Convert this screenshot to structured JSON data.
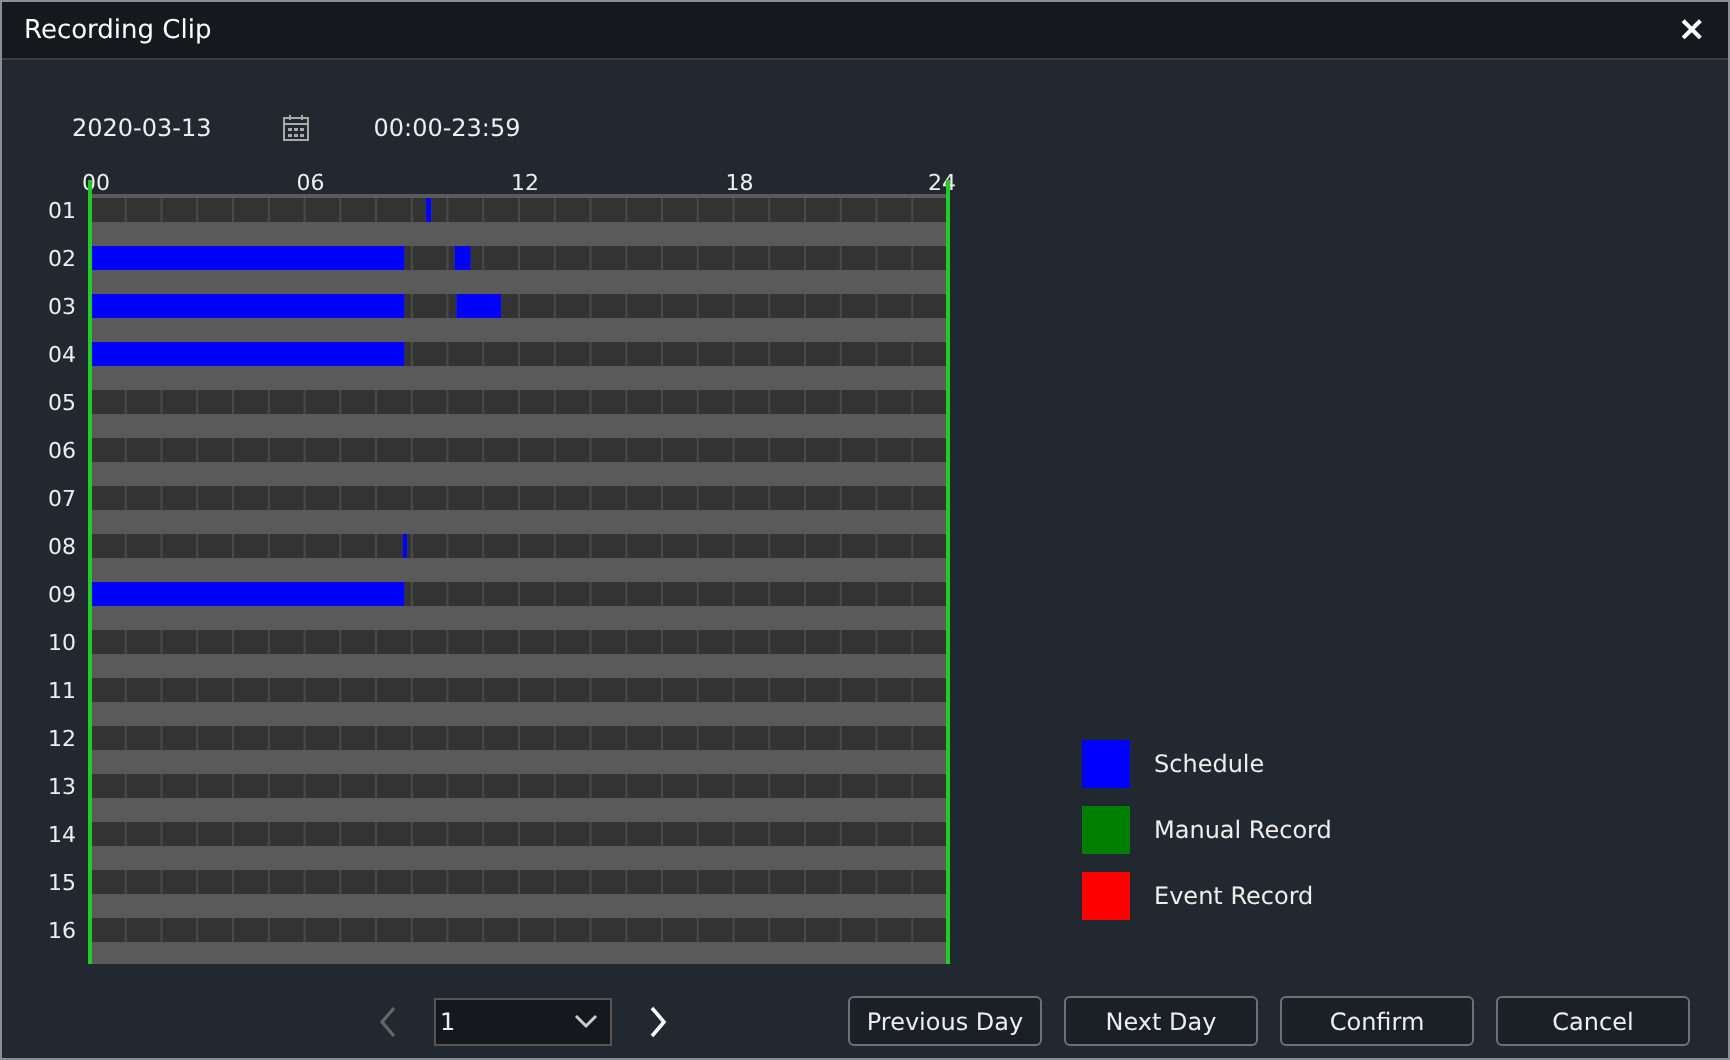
{
  "window": {
    "title": "Recording Clip",
    "close": "×"
  },
  "date": "2020-03-13",
  "time_range": "00:00-23:59",
  "timeline": {
    "chart_data": {
      "type": "bar",
      "orientation": "horizontal",
      "stacked": true,
      "categories": [
        "01",
        "02",
        "03",
        "04",
        "05",
        "06",
        "07",
        "08",
        "09",
        "10",
        "11",
        "12",
        "13",
        "14",
        "15",
        "16"
      ],
      "xlim": [
        0,
        24
      ],
      "xticks": [
        {
          "value": 0,
          "label": "00"
        },
        {
          "value": 6,
          "label": "06"
        },
        {
          "value": 12,
          "label": "12"
        },
        {
          "value": 18,
          "label": "18"
        },
        {
          "value": 24,
          "label": "24"
        }
      ],
      "series": [
        {
          "color": "#0000ff",
          "values": [
            0,
            8.8,
            8.8,
            8.8,
            0,
            0,
            0,
            0,
            8.8,
            0,
            0,
            0,
            0,
            0,
            0,
            0
          ]
        },
        {
          "color": "#333333",
          "values": [
            9.4,
            1.4,
            1.45,
            0,
            0,
            0,
            0,
            8.75,
            0,
            0,
            0,
            0,
            0,
            0,
            0,
            0
          ]
        },
        {
          "color": "#0000ff",
          "values": [
            0.15,
            0.45,
            1.25,
            0,
            0,
            0,
            0,
            0.12,
            0,
            0,
            0,
            0,
            0,
            0,
            0,
            0
          ]
        },
        {
          "color": "#333333",
          "values": [
            14.45,
            13.35,
            12.5,
            15.2,
            24,
            24,
            24,
            15.13,
            15.2,
            24,
            24,
            24,
            24,
            24,
            24,
            24
          ]
        }
      ]
    }
  },
  "legend": [
    {
      "label": "Schedule",
      "color": "#0000ff"
    },
    {
      "label": "Manual Record",
      "color": "#008000"
    },
    {
      "label": "Event Record",
      "color": "#ff0000"
    }
  ],
  "pager": {
    "previous_disabled": true,
    "next_disabled": false,
    "value": "1"
  },
  "buttons": [
    "Previous Day",
    "Next Day",
    "Confirm",
    "Cancel"
  ]
}
